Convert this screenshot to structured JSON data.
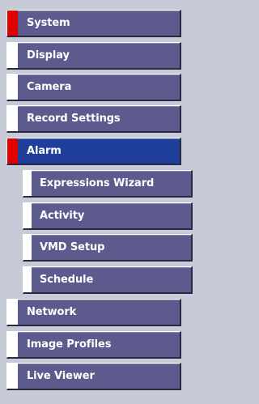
{
  "colors": {
    "background": "#c7cbd7",
    "item_bg": "#5d5b8d",
    "active_bg": "#1f3f9b",
    "indicator_active": "#e00000",
    "indicator_default": "#ffffff"
  },
  "menu": {
    "items": [
      {
        "label": "System",
        "indicator": "red"
      },
      {
        "label": "Display",
        "indicator": "white"
      },
      {
        "label": "Camera",
        "indicator": "white"
      },
      {
        "label": "Record Settings",
        "indicator": "white"
      },
      {
        "label": "Alarm",
        "indicator": "red",
        "selected": true
      }
    ],
    "alarm_subitems": [
      {
        "label": "Expressions Wizard"
      },
      {
        "label": "Activity"
      },
      {
        "label": "VMD Setup"
      },
      {
        "label": "Schedule"
      }
    ],
    "after_items": [
      {
        "label": "Network",
        "indicator": "white"
      },
      {
        "label": "Image Profiles",
        "indicator": "white"
      },
      {
        "label": "Live Viewer",
        "indicator": "white"
      }
    ]
  }
}
